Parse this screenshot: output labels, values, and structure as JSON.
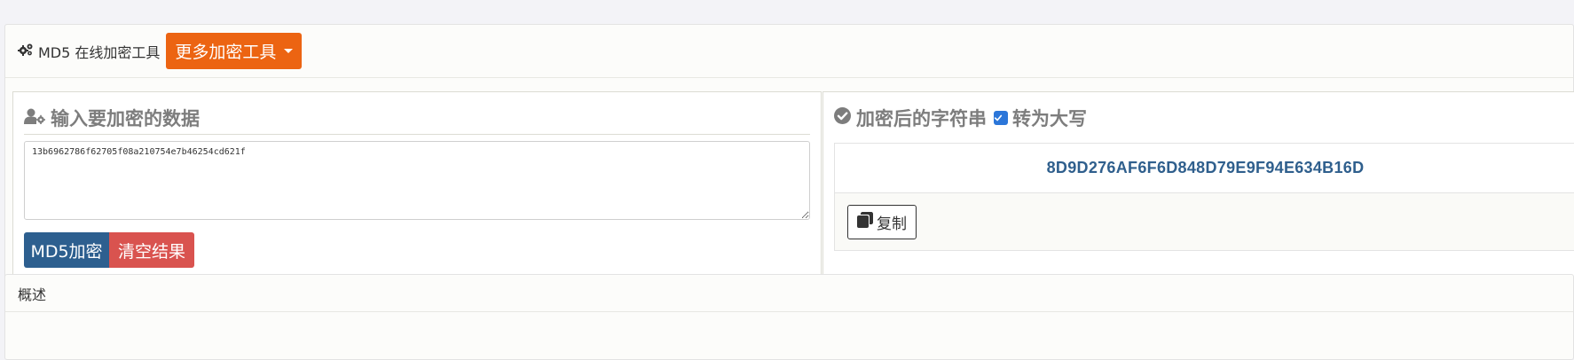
{
  "header": {
    "title": "MD5 在线加密工具",
    "more_tools_label": "更多加密工具"
  },
  "input_section": {
    "title": "输入要加密的数据",
    "value": "13b6962786f62705f08a210754e7b46254cd621f",
    "md5_button": "MD5加密",
    "clear_button": "清空结果"
  },
  "output_section": {
    "title": "加密后的字符串",
    "uppercase_label": "转为大写",
    "uppercase_checked": true,
    "result": "8D9D276AF6F6D848D79E9F94E634B16D",
    "copy_button": "复制"
  },
  "overview": {
    "title": "概述"
  },
  "colors": {
    "accent_orange": "#ec6412",
    "primary_blue": "#2d5f8f",
    "danger_red": "#d9534f",
    "result_blue": "#2f5f8d",
    "checkbox_blue": "#2b76d9"
  }
}
